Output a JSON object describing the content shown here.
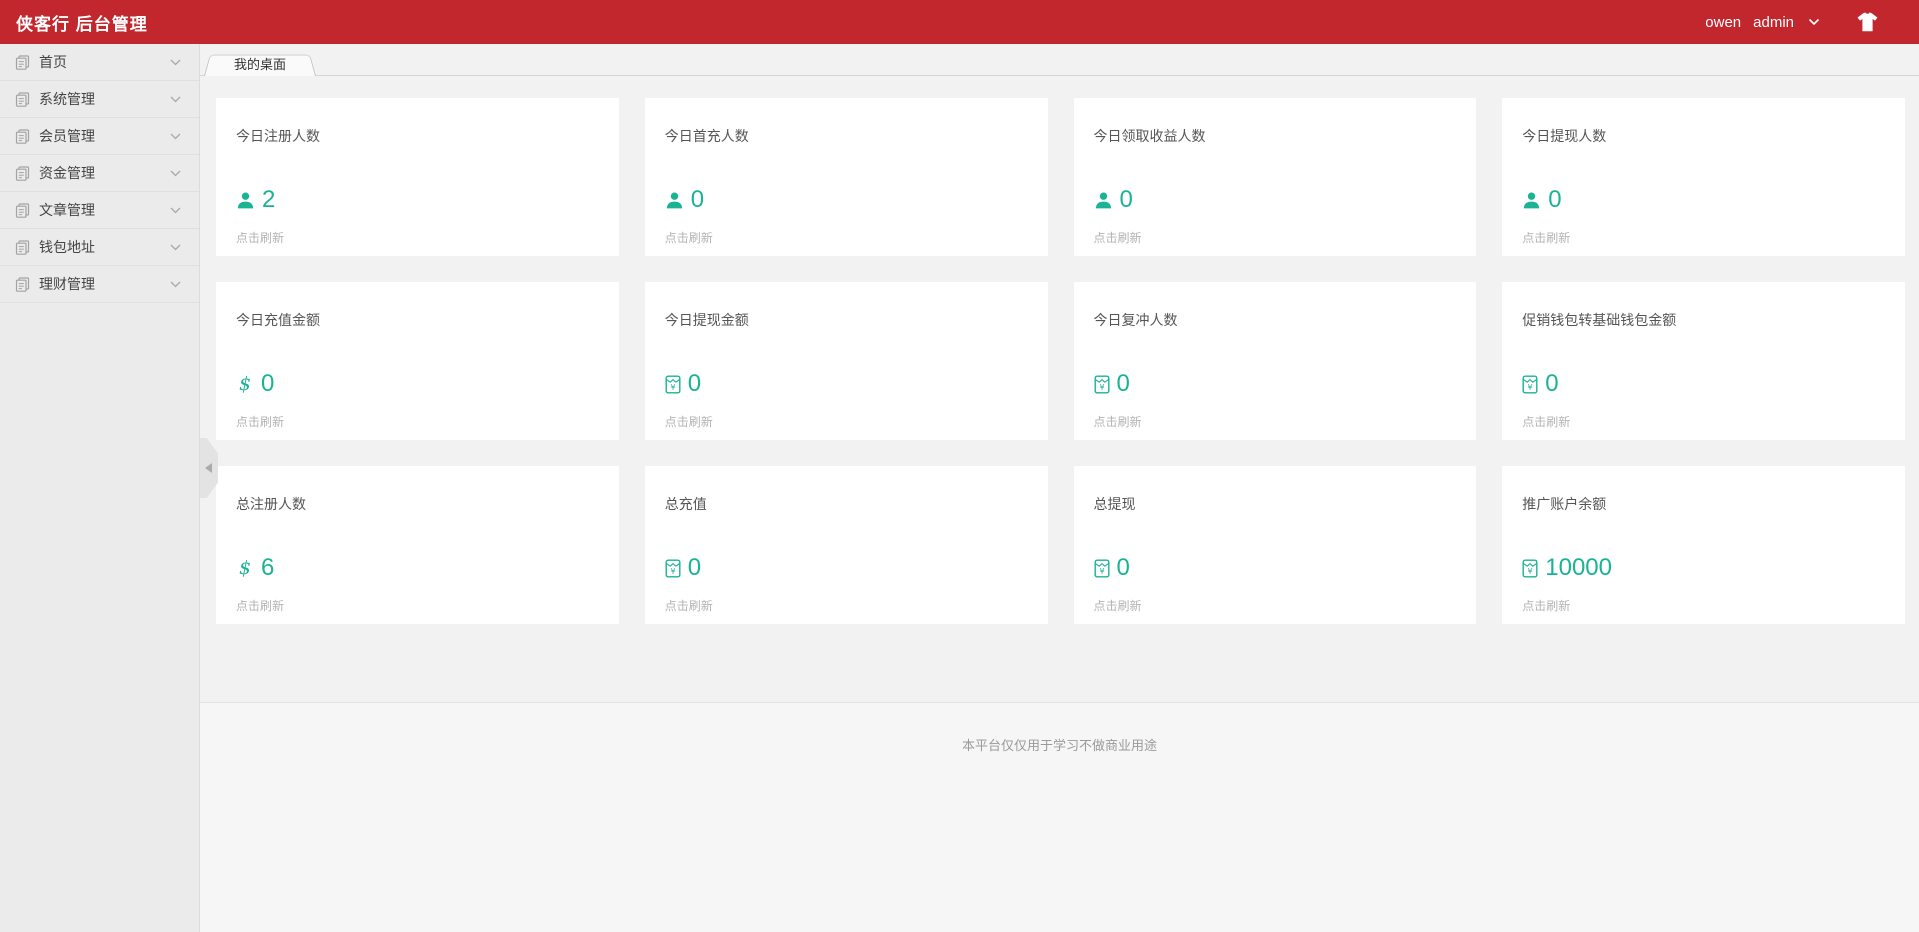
{
  "header": {
    "title": "侠客行 后台管理",
    "username": "owen",
    "role": "admin",
    "icons": {
      "dropdown": "chevron-down-icon",
      "theme": "tshirt-icon"
    },
    "bg_color": "#c1272d"
  },
  "sidebar": {
    "items": [
      {
        "name": "home",
        "label": "首页",
        "icon": "document-icon"
      },
      {
        "name": "system",
        "label": "系统管理",
        "icon": "document-icon"
      },
      {
        "name": "member",
        "label": "会员管理",
        "icon": "document-icon"
      },
      {
        "name": "funds",
        "label": "资金管理",
        "icon": "document-icon"
      },
      {
        "name": "article",
        "label": "文章管理",
        "icon": "document-icon"
      },
      {
        "name": "wallet",
        "label": "钱包地址",
        "icon": "document-icon"
      },
      {
        "name": "finance",
        "label": "理财管理",
        "icon": "document-icon"
      }
    ],
    "collapse_icon": "collapse-left-icon"
  },
  "tabs": {
    "active_label": "我的桌面"
  },
  "dashboard": {
    "accent_color": "#1ab394",
    "refresh_hint": "点击刷新",
    "cards": [
      {
        "title": "今日注册人数",
        "value": "2",
        "icon": "user-icon"
      },
      {
        "title": "今日首充人数",
        "value": "0",
        "icon": "user-icon"
      },
      {
        "title": "今日领取收益人数",
        "value": "0",
        "icon": "user-icon"
      },
      {
        "title": "今日提现人数",
        "value": "0",
        "icon": "user-icon"
      },
      {
        "title": "今日充值金额",
        "value": "0",
        "icon": "dollar-icon"
      },
      {
        "title": "今日提现金额",
        "value": "0",
        "icon": "red-packet-icon"
      },
      {
        "title": "今日复冲人数",
        "value": "0",
        "icon": "red-packet-icon"
      },
      {
        "title": "促销钱包转基础钱包金额",
        "value": "0",
        "icon": "red-packet-icon"
      },
      {
        "title": "总注册人数",
        "value": "6",
        "icon": "dollar-icon"
      },
      {
        "title": "总充值",
        "value": "0",
        "icon": "red-packet-icon"
      },
      {
        "title": "总提现",
        "value": "0",
        "icon": "red-packet-icon"
      },
      {
        "title": "推广账户余额",
        "value": "10000",
        "icon": "red-packet-icon"
      }
    ]
  },
  "footer": {
    "text": "本平台仅仅用于学习不做商业用途"
  }
}
